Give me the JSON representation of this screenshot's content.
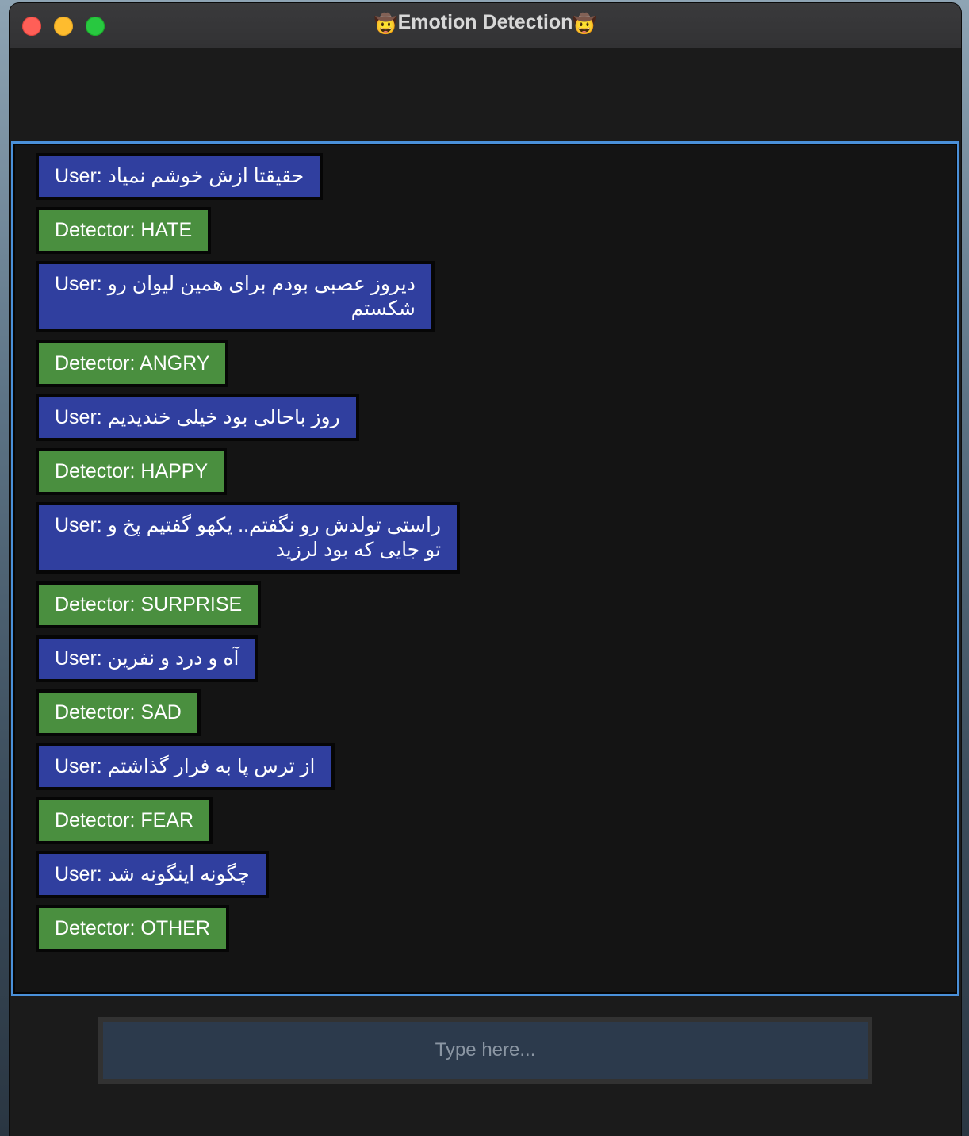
{
  "window": {
    "title": "Emotion Detection",
    "title_emoji": "🤠"
  },
  "messages": [
    {
      "role": "user",
      "label": "User:",
      "text": "حقیقتا ازش خوشم نمیاد"
    },
    {
      "role": "detector",
      "label": "Detector:",
      "text": "HATE"
    },
    {
      "role": "user",
      "label": "User:",
      "lines": [
        "دیروز عصبی بودم برای همین لیوان رو",
        "شکستم"
      ]
    },
    {
      "role": "detector",
      "label": "Detector:",
      "text": "ANGRY"
    },
    {
      "role": "user",
      "label": "User:",
      "text": "روز باحالی بود خیلی خندیدیم"
    },
    {
      "role": "detector",
      "label": "Detector:",
      "text": "HAPPY"
    },
    {
      "role": "user",
      "label": "User:",
      "lines": [
        "راستی تولدش رو نگفتم.. یکهو گفتیم پخ و",
        "تو جایی که بود لرزید"
      ]
    },
    {
      "role": "detector",
      "label": "Detector:",
      "text": "SURPRISE"
    },
    {
      "role": "user",
      "label": "User:",
      "text": "آه و درد و نفرین"
    },
    {
      "role": "detector",
      "label": "Detector:",
      "text": "SAD"
    },
    {
      "role": "user",
      "label": "User:",
      "text": "از ترس پا به فرار گذاشتم"
    },
    {
      "role": "detector",
      "label": "Detector:",
      "text": "FEAR"
    },
    {
      "role": "user",
      "label": "User:",
      "text": "چگونه اینگونه شد"
    },
    {
      "role": "detector",
      "label": "Detector:",
      "text": "OTHER"
    }
  ],
  "input": {
    "placeholder": "Type here...",
    "value": ""
  },
  "colors": {
    "user_bubble": "#303f9f",
    "detector_bubble": "#4a8f3f",
    "chat_border": "#4a90d9",
    "input_bg": "#2c3a4c"
  }
}
